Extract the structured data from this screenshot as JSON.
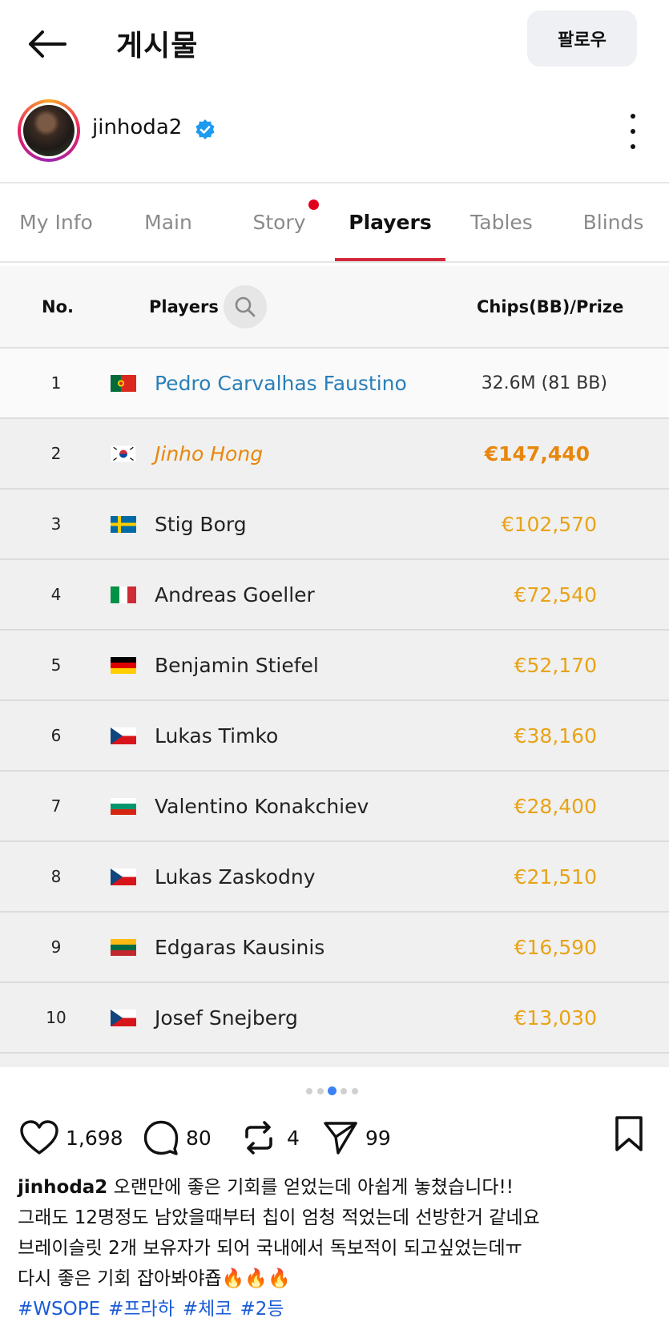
{
  "header": {
    "title": "게시물",
    "follow_label": "팔로우"
  },
  "author": {
    "username": "jinhoda2",
    "verified": true
  },
  "tabs": [
    {
      "label": "My Info",
      "active": false,
      "notification": false
    },
    {
      "label": "Main",
      "active": false,
      "notification": false
    },
    {
      "label": "Story",
      "active": false,
      "notification": true
    },
    {
      "label": "Players",
      "active": true,
      "notification": false
    },
    {
      "label": "Tables",
      "active": false,
      "notification": false
    },
    {
      "label": "Blinds",
      "active": false,
      "notification": false
    }
  ],
  "table": {
    "headers": {
      "no": "No.",
      "players": "Players",
      "prize": "Chips(BB)/Prize"
    },
    "rows": [
      {
        "rank": "1",
        "flag": "portugal",
        "name": "Pedro Carvalhas Faustino",
        "prize": "32.6M (81 BB)"
      },
      {
        "rank": "2",
        "flag": "south-korea",
        "name": "Jinho Hong",
        "prize": "€147,440"
      },
      {
        "rank": "3",
        "flag": "sweden",
        "name": "Stig Borg",
        "prize": "€102,570"
      },
      {
        "rank": "4",
        "flag": "italy",
        "name": "Andreas Goeller",
        "prize": "€72,540"
      },
      {
        "rank": "5",
        "flag": "germany",
        "name": "Benjamin Stiefel",
        "prize": "€52,170"
      },
      {
        "rank": "6",
        "flag": "czech-republic",
        "name": "Lukas Timko",
        "prize": "€38,160"
      },
      {
        "rank": "7",
        "flag": "bulgaria",
        "name": "Valentino Konakchiev",
        "prize": "€28,400"
      },
      {
        "rank": "8",
        "flag": "czech-republic",
        "name": "Lukas Zaskodny",
        "prize": "€21,510"
      },
      {
        "rank": "9",
        "flag": "lithuania",
        "name": "Edgaras Kausinis",
        "prize": "€16,590"
      },
      {
        "rank": "10",
        "flag": "czech-republic",
        "name": "Josef Snejberg",
        "prize": "€13,030"
      }
    ]
  },
  "carousel": {
    "count": 5,
    "current": 3
  },
  "actions": {
    "likes": "1,698",
    "comments": "80",
    "reposts": "4",
    "shares": "99"
  },
  "caption": {
    "username": "jinhoda2",
    "lines": [
      "오랜만에 좋은 기회를 얻었는데 아쉽게 놓쳤습니다!!",
      "그래도 12명정도 남았을때부터 칩이 엄청 적었는데 선방한거 같네요",
      "브레이슬릿 2개 보유자가 되어 국내에서 독보적이 되고싶었는데ㅠ",
      "다시 좋은 기회 잡아봐야죱🔥🔥🔥"
    ],
    "hashtags": [
      "#WSOPE",
      "#프라하",
      "#체코",
      "#2등"
    ]
  },
  "colors": {
    "accent": "#d12a3b",
    "prize": "#e8a317",
    "prize_highlight": "#e8870c",
    "first_name": "#2a7fb8",
    "hashtag": "#1a5bd6"
  }
}
